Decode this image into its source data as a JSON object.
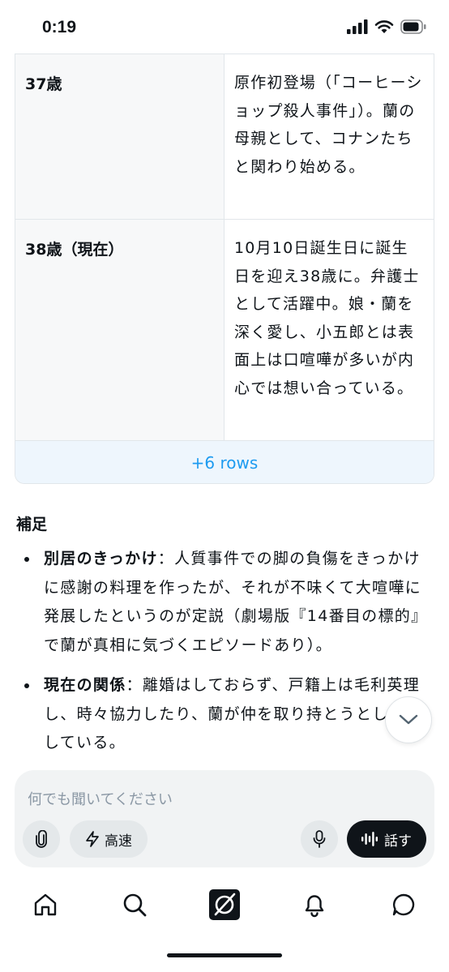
{
  "status_bar": {
    "time": "0:19"
  },
  "table": {
    "rows": [
      {
        "age": "37歳",
        "desc": "原作初登場（「コーヒーショップ殺人事件」）。蘭の母親として、コナンたちと関わり始める。"
      },
      {
        "age": "38歳（現在）",
        "desc": "10月10日誕生日に誕生日を迎え38歳に。弁護士として活躍中。娘・蘭を深く愛し、小五郎とは表面上は口喧嘩が多いが内心では想い合っている。"
      }
    ],
    "more_rows": "+6 rows"
  },
  "notes": {
    "heading": "補足",
    "bullets": [
      {
        "label": "別居のきっかけ",
        "text": "：人質事件での脚の負傷をきっかけに感謝の料理を作ったが、それが不味くて大喧嘩に発展したというのが定説（劇場版『14番目の標的』で蘭が真相に気づくエピソードあり）。"
      },
      {
        "label": "現在の関係",
        "text": "：離婚はしておらず、戸籍上は毛利英理し、時々協力したり、蘭が仲を取り持とうとしたりしている。"
      }
    ]
  },
  "composer": {
    "placeholder": "何でも聞いてください",
    "speed_label": "高速",
    "talk_label": "話す"
  },
  "icons": {
    "attach": "paperclip-icon",
    "speed": "lightning-icon",
    "mic": "microphone-icon",
    "talk": "waveform-icon",
    "scroll": "chevron-down-icon",
    "nav": [
      "home-icon",
      "search-icon",
      "grok-icon",
      "bell-icon",
      "message-icon"
    ]
  }
}
